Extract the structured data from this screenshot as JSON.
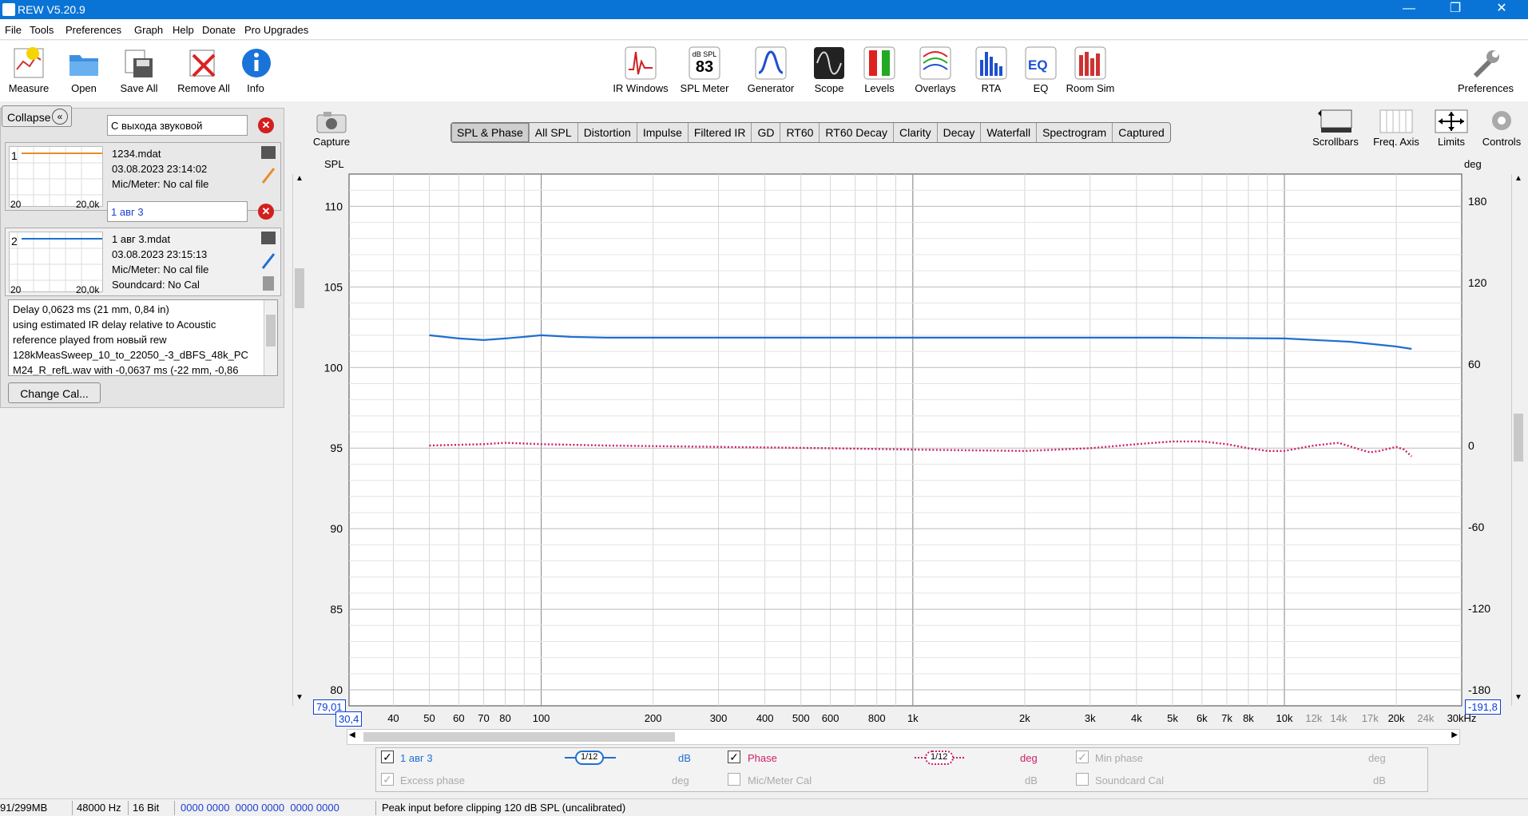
{
  "window": {
    "title": "REW V5.20.9",
    "minimize": "—",
    "maximize": "❐",
    "close": "✕"
  },
  "menu": [
    "File",
    "Tools",
    "Preferences",
    "Graph",
    "Help",
    "Donate",
    "Pro Upgrades"
  ],
  "toolbar_left": [
    {
      "label": "Measure",
      "icon": "measure-icon"
    },
    {
      "label": "Open",
      "icon": "folder-icon"
    },
    {
      "label": "Save All",
      "icon": "save-all-icon"
    },
    {
      "label": "Remove All",
      "icon": "remove-all-icon"
    },
    {
      "label": "Info",
      "icon": "info-icon"
    }
  ],
  "toolbar_center": [
    {
      "label": "IR Windows",
      "icon": "ir-windows-icon"
    },
    {
      "label": "SPL Meter",
      "icon": "spl-meter-icon",
      "badge_top": "dB SPL",
      "badge_value": "83"
    },
    {
      "label": "Generator",
      "icon": "generator-icon"
    },
    {
      "label": "Scope",
      "icon": "scope-icon"
    },
    {
      "label": "Levels",
      "icon": "levels-icon"
    },
    {
      "label": "Overlays",
      "icon": "overlays-icon"
    },
    {
      "label": "RTA",
      "icon": "rta-icon"
    },
    {
      "label": "EQ",
      "icon": "eq-icon"
    },
    {
      "label": "Room Sim",
      "icon": "room-sim-icon"
    }
  ],
  "toolbar_right": {
    "label": "Preferences",
    "icon": "wrench-icon"
  },
  "left_panel": {
    "collapse_label": "Collapse",
    "measurements": [
      {
        "index": "1",
        "name": "С выхода звуковой",
        "file": "1234.mdat",
        "date": "03.08.2023 23:14:02",
        "mic": "Mic/Meter: No cal file",
        "thumb_left": "20",
        "thumb_right": "20,0k",
        "color": "#e98b2b"
      },
      {
        "index": "2",
        "name": "1 авг 3",
        "file": "1 авг 3.mdat",
        "date": "03.08.2023 23:15:13",
        "mic": "Mic/Meter: No cal file",
        "soundcard": "Soundcard: No Cal",
        "thumb_left": "20",
        "thumb_right": "20,0k",
        "color": "#1f6fd0"
      }
    ],
    "notes": [
      "Delay 0,0623 ms (21 mm, 0,84 in)",
      "using estimated IR delay relative to Acoustic",
      "reference played from новый rew",
      "128kMeasSweep_10_to_22050_-3_dBFS_48k_PC",
      "M24_R_refL.wav with -0,0637 ms (-22 mm, -0,86"
    ],
    "change_cal_label": "Change Cal..."
  },
  "capture": {
    "label": "Capture",
    "icon": "camera-icon"
  },
  "graph_tabs": [
    "SPL & Phase",
    "All SPL",
    "Distortion",
    "Impulse",
    "Filtered IR",
    "GD",
    "RT60",
    "RT60 Decay",
    "Clarity",
    "Decay",
    "Waterfall",
    "Spectrogram",
    "Captured"
  ],
  "active_tab": "SPL & Phase",
  "graph_tools": [
    {
      "label": "Scrollbars",
      "icon": "scrollbars-icon"
    },
    {
      "label": "Freq. Axis",
      "icon": "freq-axis-icon"
    },
    {
      "label": "Limits",
      "icon": "limits-icon"
    },
    {
      "label": "Controls",
      "icon": "gear-icon"
    }
  ],
  "chart_data": {
    "type": "line",
    "ylabel": "SPL",
    "ylabel_right": "deg",
    "x_unit": "Hz",
    "x_log": true,
    "xlim": [
      30.4,
      30000
    ],
    "ylim": [
      79.01,
      112
    ],
    "ylim_right": [
      -191.8,
      200
    ],
    "y_ticks": [
      110,
      105,
      100,
      95,
      90,
      85,
      80
    ],
    "y_ticks_right": [
      180,
      120,
      60,
      0,
      -60,
      -120,
      -180
    ],
    "x_ticks": [
      "40",
      "50",
      "60",
      "70",
      "80",
      "100",
      "200",
      "300",
      "400",
      "500",
      "600",
      "800",
      "1k",
      "2k",
      "3k",
      "4k",
      "5k",
      "6k",
      "7k",
      "8k",
      "10k",
      "12k",
      "14k",
      "17k",
      "20k",
      "24k",
      "30kHz"
    ],
    "x_tick_values": [
      40,
      50,
      60,
      70,
      80,
      100,
      200,
      300,
      400,
      500,
      600,
      800,
      1000,
      2000,
      3000,
      4000,
      5000,
      6000,
      7000,
      8000,
      10000,
      12000,
      14000,
      17000,
      20000,
      24000,
      30000
    ],
    "x_min_label": "30,4",
    "y_min_label": "79,01",
    "y_right_min_label": "-191,8",
    "grid": true,
    "series": [
      {
        "name": "1 авг 3",
        "axis": "left",
        "color": "#1f6fd0",
        "style": "solid",
        "x": [
          50,
          60,
          70,
          80,
          90,
          100,
          120,
          150,
          200,
          300,
          500,
          1000,
          2000,
          5000,
          10000,
          15000,
          20000,
          22000
        ],
        "y": [
          102.0,
          101.8,
          101.7,
          101.8,
          101.9,
          102.0,
          101.9,
          101.85,
          101.85,
          101.85,
          101.85,
          101.85,
          101.85,
          101.85,
          101.8,
          101.6,
          101.3,
          101.15
        ]
      },
      {
        "name": "Phase",
        "axis": "right",
        "color": "#cc1f6a",
        "style": "dotted",
        "x": [
          50,
          70,
          80,
          100,
          150,
          300,
          600,
          1000,
          2000,
          3000,
          4000,
          5000,
          6000,
          7000,
          8000,
          9000,
          10000,
          12000,
          14000,
          16000,
          17000,
          18000,
          20000,
          21000,
          22000
        ],
        "y": [
          0,
          1,
          2,
          1,
          0,
          -1,
          -2,
          -3,
          -4,
          -2,
          1,
          3,
          3,
          1,
          -2,
          -4,
          -4,
          0,
          2,
          -3,
          -5,
          -4,
          -1,
          -3,
          -8
        ]
      }
    ]
  },
  "legend": {
    "row1": [
      {
        "checked": true,
        "label": "1 авг 3",
        "smoothing": "1/12",
        "unit": "dB",
        "enabled": true,
        "color": "#1f6fd0"
      },
      {
        "checked": true,
        "label": "Phase",
        "smoothing": "1/12",
        "unit": "deg",
        "enabled": true,
        "color": "#cc1f6a"
      },
      {
        "checked": true,
        "label": "Min phase",
        "unit": "deg",
        "enabled": false
      }
    ],
    "row2": [
      {
        "checked": true,
        "label": "Excess phase",
        "unit": "deg",
        "enabled": false
      },
      {
        "checked": false,
        "label": "Mic/Meter Cal",
        "unit": "dB",
        "enabled": false
      },
      {
        "checked": false,
        "label": "Soundcard Cal",
        "unit": "dB",
        "enabled": false
      }
    ]
  },
  "status": {
    "memory": "91/299MB",
    "rate": "48000 Hz",
    "bits": "16 Bit",
    "levels": "0000 0000  0000 0000  0000 0000",
    "message": "Peak input before clipping 120 dB SPL (uncalibrated)"
  }
}
